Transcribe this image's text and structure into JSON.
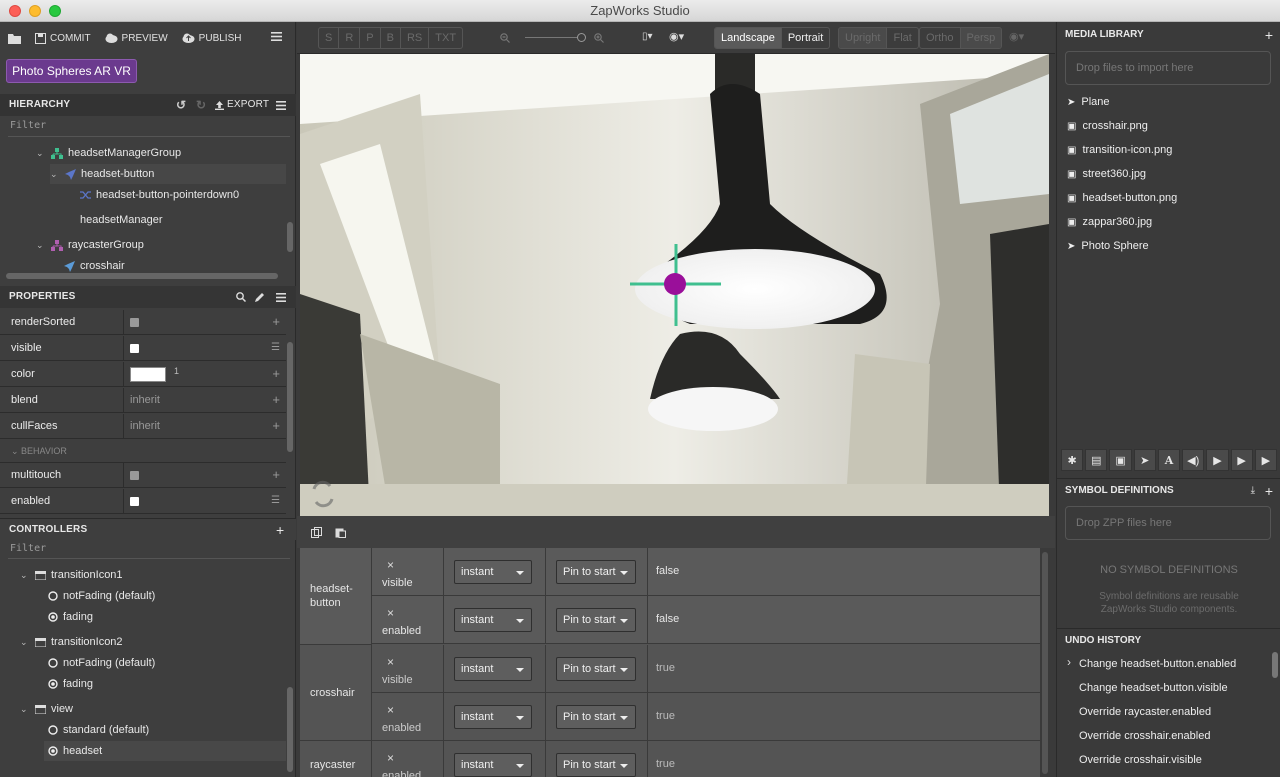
{
  "window": {
    "title": "ZapWorks Studio"
  },
  "toolbar": {
    "commit": "COMMIT",
    "preview": "PREVIEW",
    "publish": "PUBLISH"
  },
  "project": {
    "name": "Photo Spheres AR VR"
  },
  "hierarchy": {
    "title": "HIERARCHY",
    "export": "EXPORT",
    "filter": "Filter",
    "items": [
      {
        "label": "headsetManagerGroup"
      },
      {
        "label": "headset-button"
      },
      {
        "label": "headset-button-pointerdown0"
      },
      {
        "label": "headsetManager"
      },
      {
        "label": "raycasterGroup"
      },
      {
        "label": "crosshair"
      }
    ]
  },
  "properties": {
    "title": "PROPERTIES",
    "section_behavior": "BEHAVIOR",
    "rows": [
      {
        "name": "renderSorted",
        "value": ""
      },
      {
        "name": "visible",
        "value": ""
      },
      {
        "name": "color",
        "value": "1"
      },
      {
        "name": "blend",
        "value": "inherit"
      },
      {
        "name": "cullFaces",
        "value": "inherit"
      },
      {
        "name": "multitouch",
        "value": ""
      },
      {
        "name": "enabled",
        "value": ""
      }
    ]
  },
  "controllers": {
    "title": "CONTROLLERS",
    "filter": "Filter",
    "items": [
      {
        "label": "transitionIcon1"
      },
      {
        "label": "notFading (default)"
      },
      {
        "label": "fading"
      },
      {
        "label": "transitionIcon2"
      },
      {
        "label": "notFading (default)"
      },
      {
        "label": "fading"
      },
      {
        "label": "view"
      },
      {
        "label": "standard (default)"
      },
      {
        "label": "headset"
      }
    ]
  },
  "viewer": {
    "segs1": [
      "S",
      "R",
      "P",
      "B",
      "RS",
      "TXT"
    ],
    "landscape": "Landscape",
    "portrait": "Portrait",
    "upright": "Upright",
    "flat": "Flat",
    "ortho": "Ortho",
    "persp": "Persp"
  },
  "timeline": {
    "groups": [
      {
        "name": "headset-button"
      },
      {
        "name": "crosshair"
      },
      {
        "name": "raycaster"
      }
    ],
    "rows": [
      {
        "prop": "visible",
        "ease": "instant",
        "pin": "Pin to start",
        "value": "false"
      },
      {
        "prop": "enabled",
        "ease": "instant",
        "pin": "Pin to start",
        "value": "false"
      },
      {
        "prop": "visible",
        "ease": "instant",
        "pin": "Pin to start",
        "value": "true"
      },
      {
        "prop": "enabled",
        "ease": "instant",
        "pin": "Pin to start",
        "value": "true"
      },
      {
        "prop": "enabled",
        "ease": "instant",
        "pin": "Pin to start",
        "value": "true"
      }
    ],
    "x_mark": "×"
  },
  "media": {
    "title": "MEDIA LIBRARY",
    "drop": "Drop files to import here",
    "items": [
      {
        "label": "Plane"
      },
      {
        "label": "crosshair.png"
      },
      {
        "label": "transition-icon.png"
      },
      {
        "label": "street360.jpg"
      },
      {
        "label": "headset-button.png"
      },
      {
        "label": "zappar360.jpg"
      },
      {
        "label": "Photo Sphere"
      }
    ]
  },
  "symbols": {
    "title": "SYMBOL DEFINITIONS",
    "drop": "Drop ZPP files here",
    "empty": "NO SYMBOL DEFINITIONS",
    "desc": "Symbol definitions are reusable ZapWorks Studio components."
  },
  "undo": {
    "title": "UNDO HISTORY",
    "items": [
      {
        "label": "Change headset-button.enabled"
      },
      {
        "label": "Change headset-button.visible"
      },
      {
        "label": "Override raycaster.enabled"
      },
      {
        "label": "Override crosshair.enabled"
      },
      {
        "label": "Override crosshair.visible"
      }
    ]
  },
  "colors": {
    "accent": "#6b3a8e",
    "crosshair_line": "#3fbf8f",
    "crosshair_dot": "#9a0f9a"
  }
}
